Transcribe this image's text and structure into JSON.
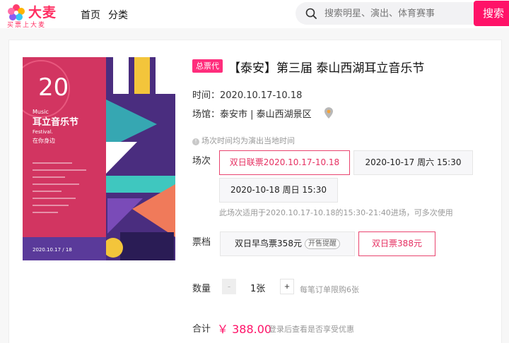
{
  "header": {
    "logo_text": "大麦",
    "logo_sub": "买票上大麦",
    "nav": [
      {
        "label": "首页"
      },
      {
        "label": "分类"
      }
    ],
    "search": {
      "placeholder": "搜索明星、演出、体育赛事",
      "button_label": "搜索"
    }
  },
  "event": {
    "badge": "总票代",
    "title": "【泰安】第三届 泰山西湖耳立音乐节",
    "time_label": "时间：",
    "time_value": "2020.10.17-10.18",
    "venue_label": "场馆：",
    "venue_value": "泰安市 | 泰山西湖景区",
    "tip": "场次时间均为演出当地时间"
  },
  "poster": {
    "number": "20",
    "music": "Music",
    "name": "耳立音乐节",
    "festival": "Festival.",
    "slogan": "在你身边",
    "date": "2020.10.17 / 18"
  },
  "sessions": {
    "label": "场次",
    "options": [
      {
        "label": "双日联票2020.10.17-10.18",
        "selected": true
      },
      {
        "label": "2020-10-17 周六 15:30",
        "selected": false
      },
      {
        "label": "2020-10-18 周日 15:30",
        "selected": false
      }
    ],
    "note": "此场次适用于2020.10.17-10.18的15:30-21:40进场，可多次使用"
  },
  "tiers": {
    "label": "票档",
    "options": [
      {
        "label": "双日早鸟票358元",
        "tag": "开售提醒",
        "selected": false
      },
      {
        "label": "双日票388元",
        "selected": true
      }
    ]
  },
  "quantity": {
    "label": "数量",
    "minus": "-",
    "value": "1张",
    "plus": "+",
    "limit": "每笔订单限购6张"
  },
  "total": {
    "label": "合计",
    "price": "￥ 388.00",
    "note": "登录后查看是否享受优惠"
  },
  "colors": {
    "brand": "#ff1268",
    "badge": "#ff2d7c",
    "selected_border": "#e9446f"
  }
}
